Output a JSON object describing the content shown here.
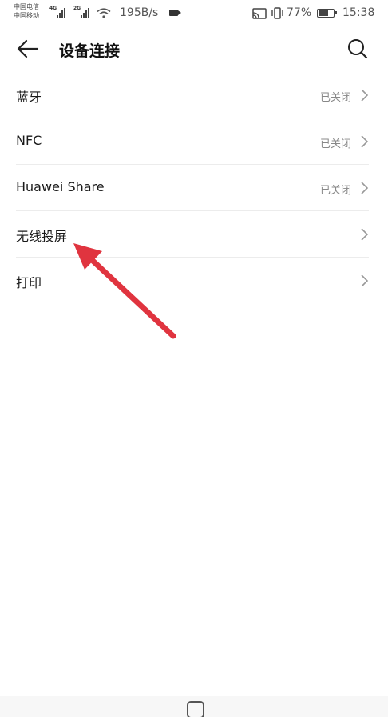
{
  "status_bar": {
    "carrier_1": "中国电信",
    "carrier_2": "中国移动",
    "sim1_tag": "4G",
    "sim2_tag": "2G",
    "net_speed": "195B/s",
    "battery": "77%",
    "battery_level": 0.77,
    "time": "15:38"
  },
  "header": {
    "title": "设备连接",
    "back_icon": "arrow-left-icon",
    "search_icon": "search-icon"
  },
  "settings": [
    {
      "label": "蓝牙",
      "value": "已关闭"
    },
    {
      "label": "NFC",
      "value": "已关闭"
    },
    {
      "label": "Huawei Share",
      "value": "已关闭"
    },
    {
      "label": "无线投屏",
      "value": ""
    },
    {
      "label": "打印",
      "value": ""
    }
  ],
  "colors": {
    "annotation_arrow": "#e0343f",
    "text_primary": "#1a1a1a",
    "text_secondary": "#888888"
  }
}
